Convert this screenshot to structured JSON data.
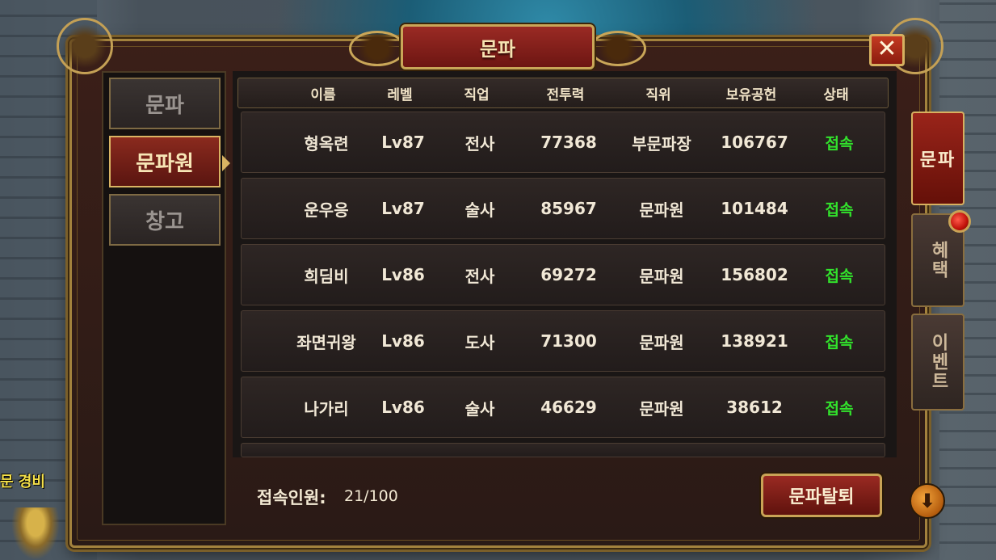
{
  "title": "문파",
  "close_glyph": "✕",
  "left_tabs": [
    {
      "label": "문파",
      "active": false
    },
    {
      "label": "문파원",
      "active": true
    },
    {
      "label": "창고",
      "active": false
    }
  ],
  "table": {
    "headers": [
      "이름",
      "레벨",
      "직업",
      "전투력",
      "직위",
      "보유공헌",
      "상태"
    ],
    "rows": [
      [
        "형옥련",
        "Lv87",
        "전사",
        "77368",
        "부문파장",
        "106767",
        "접속"
      ],
      [
        "운우응",
        "Lv87",
        "술사",
        "85967",
        "문파원",
        "101484",
        "접속"
      ],
      [
        "희딤비",
        "Lv86",
        "전사",
        "69272",
        "문파원",
        "156802",
        "접속"
      ],
      [
        "좌면귀왕",
        "Lv86",
        "도사",
        "71300",
        "문파원",
        "138921",
        "접속"
      ],
      [
        "나가리",
        "Lv86",
        "술사",
        "46629",
        "문파원",
        "38612",
        "접속"
      ]
    ]
  },
  "footer": {
    "online_label": "접속인원:",
    "online_value": "21/100",
    "leave_button": "문파탈퇴"
  },
  "right_tabs": [
    {
      "label": "문파",
      "active": true
    },
    {
      "label": "혜택",
      "active": false
    },
    {
      "label": "이벤트",
      "active": false
    }
  ],
  "world": {
    "npc_label": "문 경비",
    "orb_glyph": "⬇"
  },
  "colors": {
    "status_online": "#32e22c",
    "accent_red": "#9a241a",
    "gold_border": "#c9a356"
  }
}
